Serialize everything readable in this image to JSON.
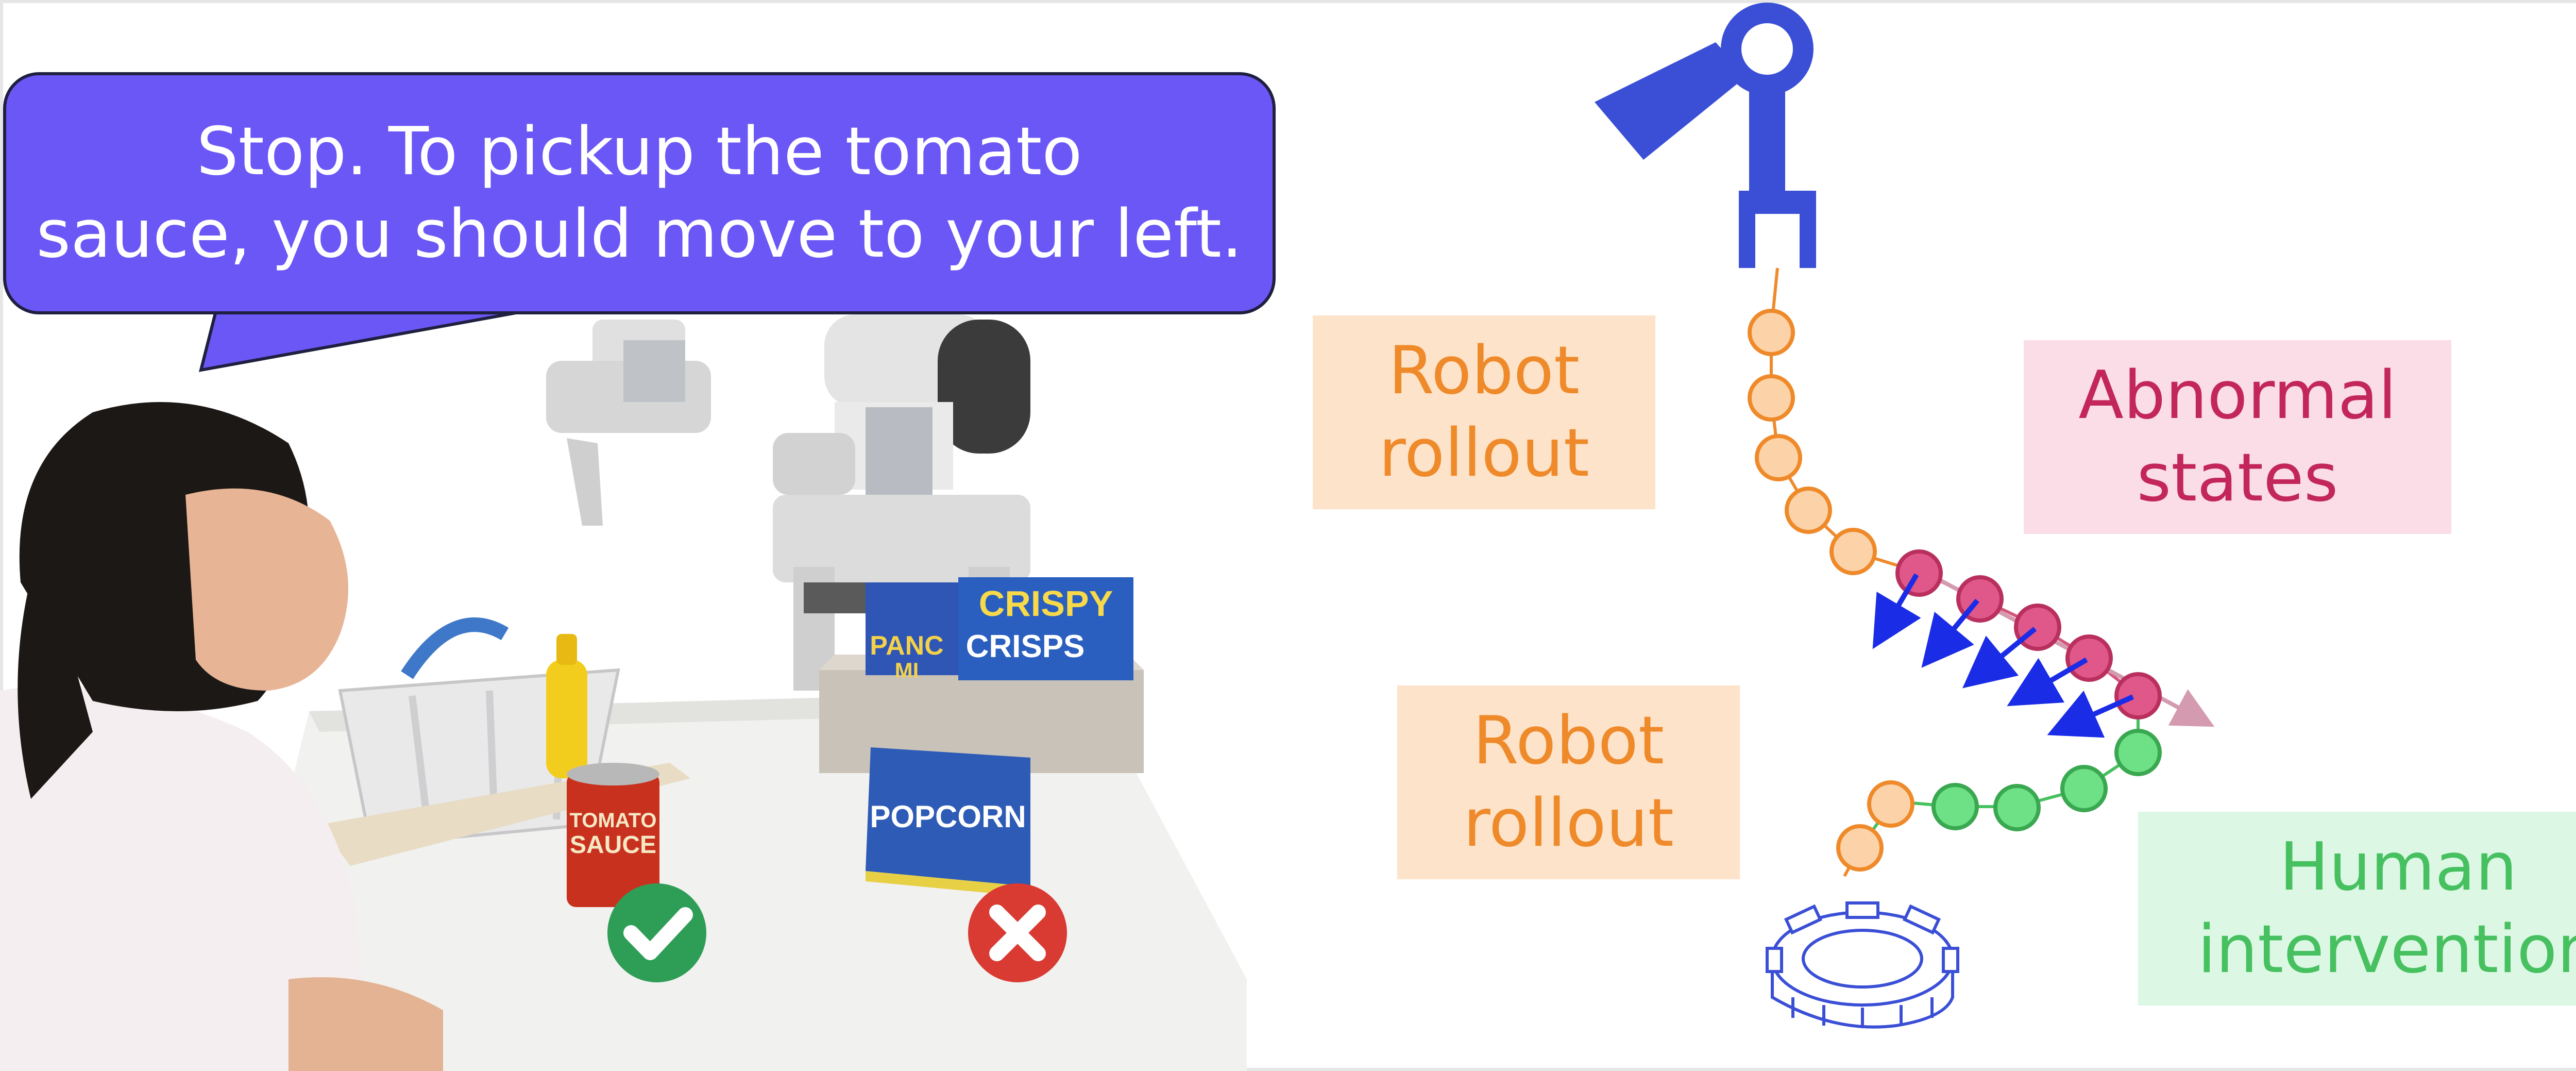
{
  "speech_bubble": {
    "lines": [
      "Stop. To pickup the tomato",
      "sauce, you should move to your left."
    ]
  },
  "scene": {
    "products": {
      "tomato_can_label": [
        "TOMATO",
        "SAUCE"
      ],
      "popcorn_box_label": "POPCORN",
      "crispy_box_label": [
        "CRISPY",
        "CRISPS"
      ],
      "pancake_box_label": [
        "PANC",
        "MI"
      ]
    }
  },
  "labels": {
    "robot_rollout_top": [
      "Robot",
      "rollout"
    ],
    "robot_rollout_bottom": [
      "Robot",
      "rollout"
    ],
    "abnormal_states": [
      "Abnormal",
      "states"
    ],
    "human_intervention": [
      "Human",
      "intervention"
    ]
  },
  "colors": {
    "bubble": "#6a57f6",
    "rollout_fill": "#fde3c9",
    "rollout_text": "#ef8a2b",
    "abnormal_fill": "#fadde6",
    "abnormal_text": "#c2265b",
    "human_fill": "#dcf8e5",
    "human_text": "#47c060",
    "gripper": "#3a4fd6",
    "correct": "#2e9e57",
    "wrong": "#d93b33"
  },
  "icons": {
    "correct_mark": "check-icon",
    "wrong_mark": "x-icon",
    "robot": "robot-gripper-icon",
    "target": "gear-icon"
  }
}
